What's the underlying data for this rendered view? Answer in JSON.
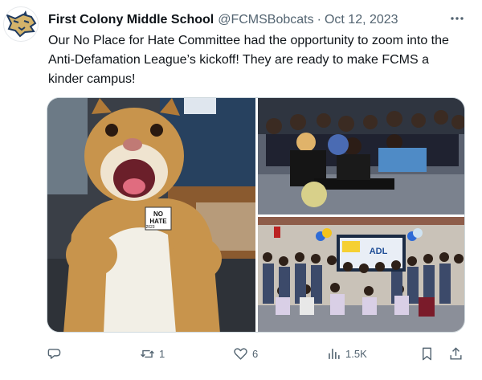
{
  "author": {
    "display_name": "First Colony Middle School",
    "handle": "@FCMSBobcats",
    "separator": "·",
    "date": "Oct 12, 2023"
  },
  "tweet": {
    "text": "Our No Place for Hate Committee had the opportunity to zoom into the Anti-Defamation League’s kickoff! They are ready to make FCMS a kinder campus!"
  },
  "media": {
    "badge_line1": "NO",
    "badge_line2": "HATE",
    "badge_number": "2023",
    "screen_text": "ADL"
  },
  "metrics": {
    "reposts": "1",
    "likes": "6",
    "views": "1.5K"
  },
  "colors": {
    "text_primary": "#0f1419",
    "text_secondary": "#536471",
    "border": "#cfd9de"
  },
  "icons": [
    "bobcat-logo-icon",
    "more-icon",
    "reply-icon",
    "repost-icon",
    "like-icon",
    "views-icon",
    "bookmark-icon",
    "share-icon"
  ]
}
